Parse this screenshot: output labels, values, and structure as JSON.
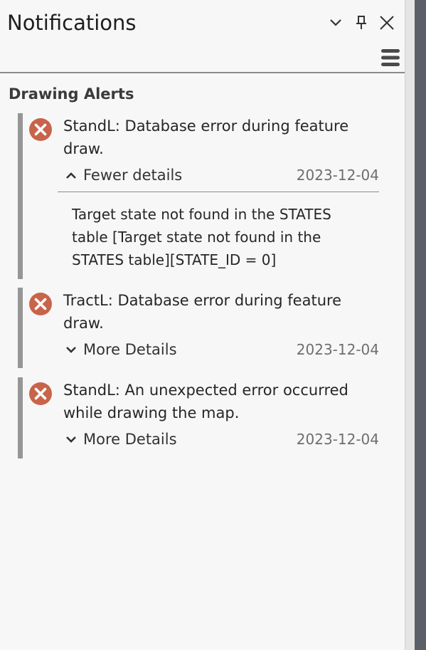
{
  "panel": {
    "title": "Notifications",
    "icons": {
      "dropdown": "chevron-down-icon",
      "pin": "pin-icon",
      "close": "close-icon",
      "menu": "hamburger-menu-icon"
    }
  },
  "section": {
    "title": "Drawing Alerts"
  },
  "notifications": [
    {
      "message": "StandL: Database error during feature draw.",
      "toggle_label": "Fewer details",
      "expanded": true,
      "date": "2023-12-04",
      "details": "Target state not found in the STATES table [Target state not found in the STATES table][STATE_ID = 0]",
      "icon": "error-icon"
    },
    {
      "message": "TractL: Database error during feature draw.",
      "toggle_label": "More Details",
      "expanded": false,
      "date": "2023-12-04",
      "icon": "error-icon"
    },
    {
      "message": "StandL: An unexpected error occurred while drawing the map.",
      "toggle_label": "More Details",
      "expanded": false,
      "date": "2023-12-04",
      "icon": "error-icon"
    }
  ],
  "colors": {
    "error_icon": "#c8644a",
    "accent_bar": "#969696",
    "background": "#f7f7f7"
  }
}
